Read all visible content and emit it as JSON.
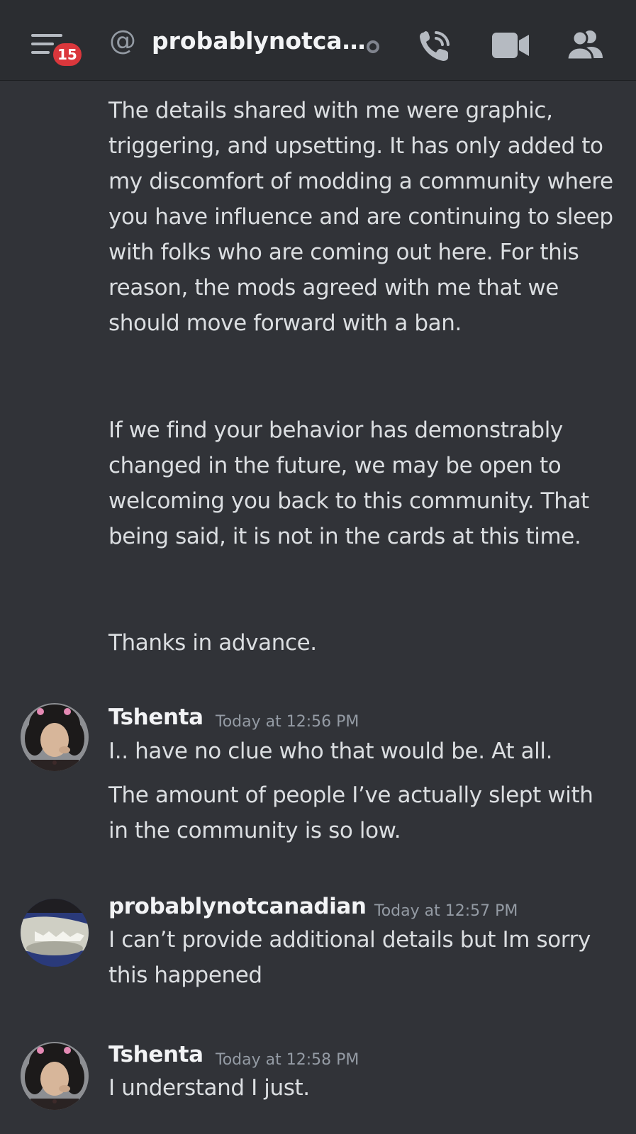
{
  "header": {
    "notification_count": "15",
    "at_symbol": "@",
    "channel_name": "probablynotca…"
  },
  "messages": {
    "continued": {
      "paragraphs": [
        "The details shared with me were graphic, triggering, and upsetting. It has only added to my discomfort of modding a community where you have influence and are continuing to sleep with folks who are coming out here. For this reason, the mods agreed with me that we should move forward with a ban.",
        "If we find your behavior has demonstrably changed in the future, we may be open to welcoming you back to this community. That being said, it is not in the cards at this time.",
        "Thanks in advance."
      ]
    },
    "group1": {
      "author": "Tshenta",
      "timestamp": "Today at 12:56 PM",
      "lines": [
        "I.. have no clue who that would be. At all.",
        "The amount of people I’ve actually slept with in the community is so low."
      ]
    },
    "group2": {
      "author": "probablynotcanadian",
      "timestamp": "Today at 12:57 PM",
      "lines": [
        "I can’t provide additional details but Im sorry this happened"
      ]
    },
    "group3": {
      "author": "Tshenta",
      "timestamp": "Today at 12:58 PM",
      "lines": [
        "I understand I just."
      ]
    }
  },
  "colors": {
    "background": "#313338",
    "header": "#2b2d31",
    "badge": "#da373c",
    "text": "#dbdee1",
    "muted": "#949ba4"
  }
}
